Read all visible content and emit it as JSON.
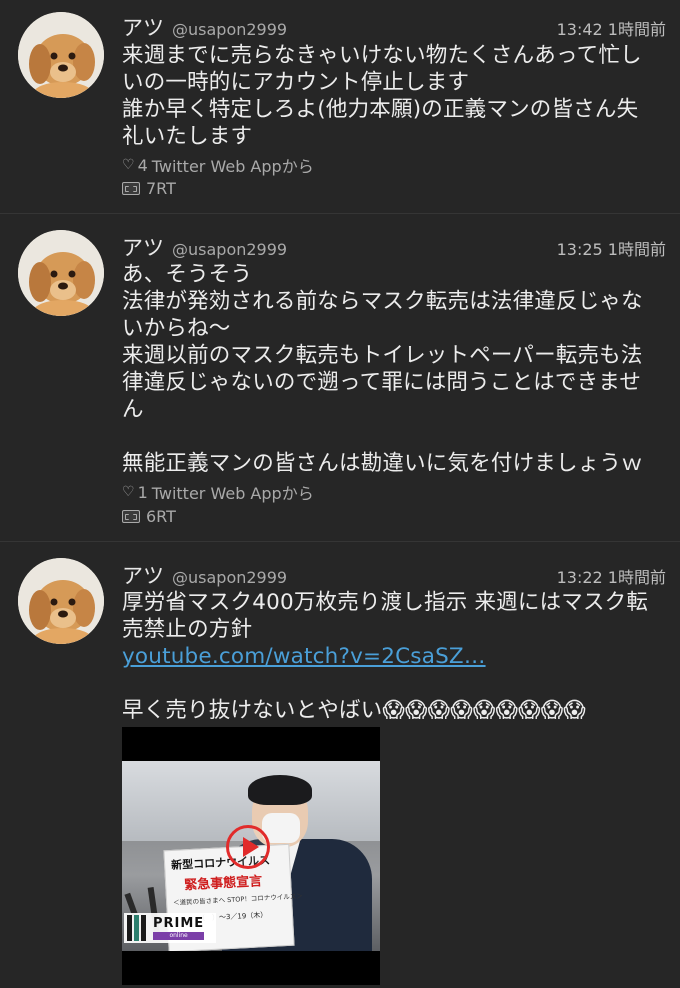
{
  "colors": {
    "background": "#262626",
    "text": "#ececec",
    "muted": "#a9a9a9",
    "link": "#4a9fd8",
    "divider": "#353535"
  },
  "tweets": [
    {
      "display_name": "アツ",
      "handle": "@usapon2999",
      "time": "13:42 1時間前",
      "lines": [
        "来週までに売らなきゃいけない物たくさんあって忙し",
        "いの一時的にアカウント停止します",
        "誰か早く特定しろよ(他力本願)の正義マンの皆さん失",
        "礼いたします"
      ],
      "likes": "4",
      "source": "Twitter Web Appから",
      "retweets": "7RT",
      "avatar_icon": "puppy-avatar-icon"
    },
    {
      "display_name": "アツ",
      "handle": "@usapon2999",
      "time": "13:25 1時間前",
      "lines": [
        "あ、そうそう",
        "法律が発効される前ならマスク転売は法律違反じゃな",
        "いからね〜",
        "来週以前のマスク転売もトイレットペーパー転売も法",
        "律違反じゃないので遡って罪には問うことはできませ",
        "ん",
        "",
        "無能正義マンの皆さんは勘違いに気を付けましょうｗ"
      ],
      "likes": "1",
      "source": "Twitter Web Appから",
      "retweets": "6RT",
      "avatar_icon": "puppy-avatar-icon"
    },
    {
      "display_name": "アツ",
      "handle": "@usapon2999",
      "time": "13:22 1時間前",
      "lines": [
        "厚労省マスク400万枚売り渡し指示 来週にはマスク転",
        "売禁止の方針"
      ],
      "link": "youtube.com/watch?v=2CsaSZ…",
      "after_link": "早く売り抜けないとやばい😱😱😱😱😱😱😱😱😱",
      "avatar_icon": "puppy-avatar-icon",
      "media": {
        "sign_title": "新型コロナウイルス",
        "sign_red": "緊急事態宣言",
        "sign_small": "＜道民の皆さまへ STOP！コロナウイルス＞",
        "sign_date": "（　）〜3／19（木）",
        "logo_prime": "PRIME",
        "logo_online": "online",
        "play_icon": "play-button-icon"
      }
    }
  ]
}
